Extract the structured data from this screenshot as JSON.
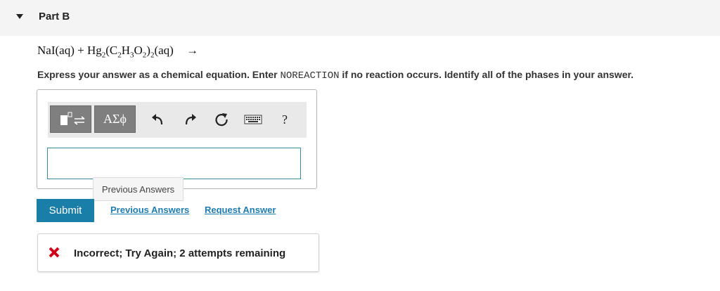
{
  "header": {
    "title": "Part B"
  },
  "equation": {
    "reactant1": "NaI(aq)",
    "plus": "+",
    "hg": "Hg",
    "hg_sub": "2",
    "paren_open": "(C",
    "c_sub": "2",
    "h": "H",
    "h_sub": "3",
    "o": "O",
    "o_sub": "2",
    "paren_close": ")",
    "group_sub": "2",
    "state": "(aq)",
    "arrow": "→"
  },
  "instructions": {
    "before": "Express your answer as a chemical equation. Enter ",
    "keyword": "NOREACTION",
    "after": " if no reaction occurs. Identify all of the phases in your answer."
  },
  "toolbar": {
    "templates_icon": "templates-icon",
    "symbols_label": "ΑΣϕ",
    "undo_icon": "undo-icon",
    "redo_icon": "redo-icon",
    "reset_icon": "reset-icon",
    "keyboard_icon": "keyboard-icon",
    "help_label": "?"
  },
  "answer": {
    "value": ""
  },
  "previous_answers_tag": "Previous Answers",
  "actions": {
    "submit_label": "Submit",
    "previous_answers_label": "Previous Answers",
    "request_answer_label": "Request Answer"
  },
  "feedback": {
    "icon": "x-icon",
    "text": "Incorrect; Try Again; 2 attempts remaining"
  },
  "colors": {
    "submit_bg": "#1a7fa8",
    "link": "#1d7db3",
    "error_x": "#d0021b",
    "input_border": "#2f8f9c"
  }
}
